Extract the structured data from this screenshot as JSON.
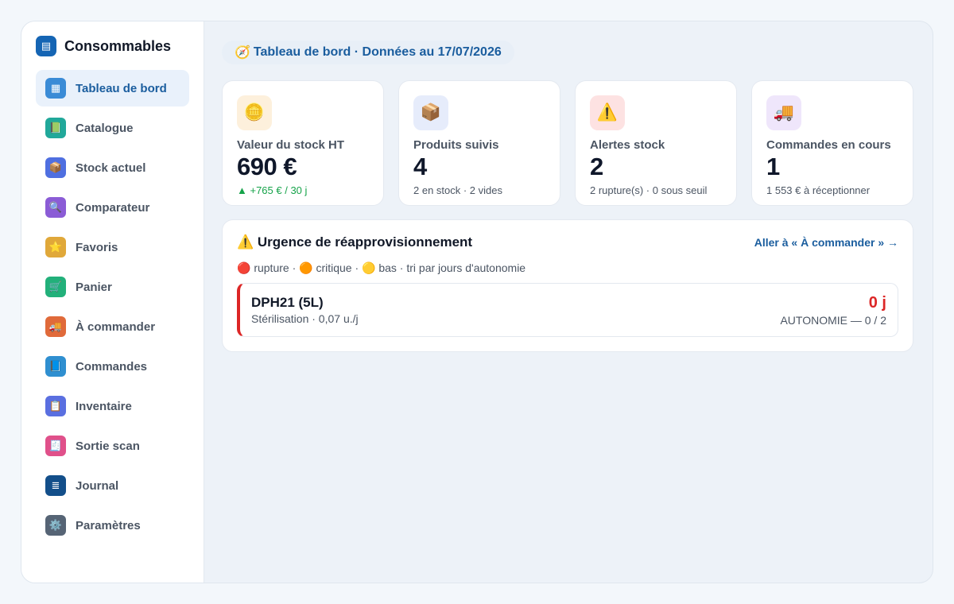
{
  "app": {
    "title": "Consommables",
    "icon": "list-icon"
  },
  "sidebar": {
    "items": [
      {
        "label": "Tableau de bord",
        "icon": "dashboard-icon",
        "glyph": "▦",
        "color": "#3a8bd6",
        "active": true
      },
      {
        "label": "Catalogue",
        "icon": "book-icon",
        "glyph": "📗",
        "color": "#21a89a",
        "active": false
      },
      {
        "label": "Stock actuel",
        "icon": "box-icon",
        "glyph": "📦",
        "color": "#4f6fe0",
        "active": false
      },
      {
        "label": "Comparateur",
        "icon": "magnifier-icon",
        "glyph": "🔍",
        "color": "#8b5cd6",
        "active": false
      },
      {
        "label": "Favoris",
        "icon": "star-icon",
        "glyph": "⭐",
        "color": "#e0a83a",
        "active": false
      },
      {
        "label": "Panier",
        "icon": "cart-icon",
        "glyph": "🛒",
        "color": "#22b07a",
        "active": false
      },
      {
        "label": "À commander",
        "icon": "truck-icon",
        "glyph": "🚚",
        "color": "#e06a3a",
        "active": false
      },
      {
        "label": "Commandes",
        "icon": "ledger-icon",
        "glyph": "📘",
        "color": "#2f8fd0",
        "active": false
      },
      {
        "label": "Inventaire",
        "icon": "clipboard-icon",
        "glyph": "📋",
        "color": "#5a6fe0",
        "active": false
      },
      {
        "label": "Sortie scan",
        "icon": "receipt-icon",
        "glyph": "🧾",
        "color": "#e0508a",
        "active": false
      },
      {
        "label": "Journal",
        "icon": "log-icon",
        "glyph": "≣",
        "color": "#134f8a",
        "active": false
      },
      {
        "label": "Paramètres",
        "icon": "gear-icon",
        "glyph": "⚙️",
        "color": "#566475",
        "active": false
      }
    ]
  },
  "header": {
    "crumb": "Tableau de bord · Données au 17/07/2026",
    "icon": "compass-icon"
  },
  "kpis": [
    {
      "label": "Valeur du stock HT",
      "value": "690 €",
      "sub": "▲ +765 € / 30 j",
      "icon": "coins-icon",
      "glyph": "🪙",
      "bg": "#fdf0dc",
      "trend": "up"
    },
    {
      "label": "Produits suivis",
      "value": "4",
      "sub": "2 en stock · 2 vides",
      "icon": "package-icon",
      "glyph": "📦",
      "bg": "#e6ecfb",
      "trend": "none"
    },
    {
      "label": "Alertes stock",
      "value": "2",
      "sub": "2 rupture(s) · 0 sous seuil",
      "icon": "warning-icon",
      "glyph": "⚠️",
      "bg": "#fde2e2",
      "trend": "none"
    },
    {
      "label": "Commandes en cours",
      "value": "1",
      "sub": "1 553 € à réceptionner",
      "icon": "delivery-truck-icon",
      "glyph": "🚚",
      "bg": "#efe6fb",
      "trend": "none"
    }
  ],
  "urgency": {
    "title": "⚠️ Urgence de réapprovisionnement",
    "link": "Aller à « À commander » →",
    "legend": "🔴 rupture · 🟠 critique · 🟡 bas · tri par jours d'autonomie",
    "rows": [
      {
        "name": "DPH21 (5L)",
        "meta": "Stérilisation · 0,07 u./j",
        "days": "0 j",
        "autonomy": "AUTONOMIE — 0 / 2",
        "severity_color": "#dc2626"
      }
    ]
  }
}
